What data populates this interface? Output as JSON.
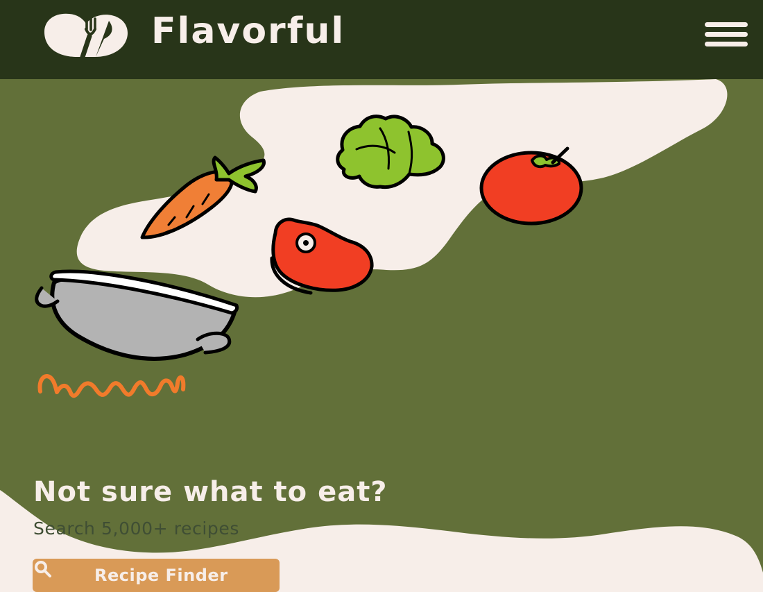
{
  "brand": {
    "name": "Flavorful",
    "logo_icon": "cutlery-heart-icon",
    "menu_icon": "hamburger-menu-icon"
  },
  "hero": {
    "headline": "Not sure what to eat?",
    "subheadline": "Search 5,000+ recipes",
    "cta_label": "Recipe Finder",
    "cta_icon": "search-icon",
    "illustration_items": [
      "pot-icon",
      "carrot-icon",
      "lettuce-icon",
      "tomato-icon",
      "steak-icon",
      "flame-icon"
    ]
  },
  "colors": {
    "header_bg": "#283519",
    "hero_bg": "#627039",
    "cream": "#F7EEE9",
    "accent": "#D99A57",
    "flame": "#F17B2B",
    "tomato": "#F13E23",
    "carrot": "#F07F36",
    "lettuce": "#8EC32E"
  }
}
